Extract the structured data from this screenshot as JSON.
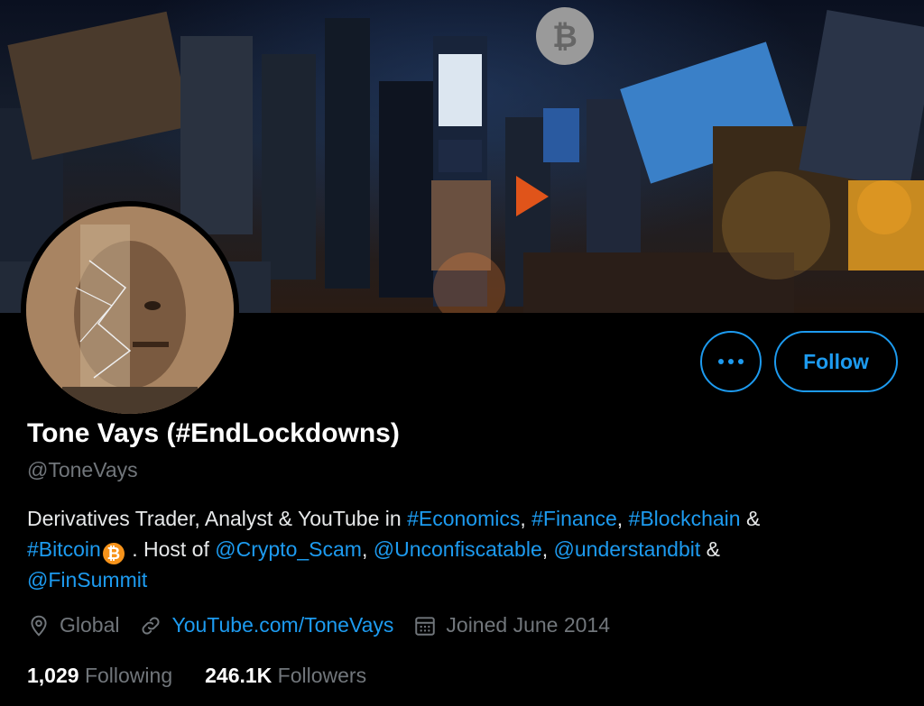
{
  "profile": {
    "display_name": "Tone Vays (#EndLockdowns)",
    "handle": "@ToneVays",
    "bio": {
      "part1": "Derivatives Trader, Analyst & YouTube in ",
      "tag_economics": "#Economics",
      "sep1": ", ",
      "tag_finance": "#Finance",
      "sep2": ", ",
      "tag_blockchain": "#Blockchain",
      "sep3": " & ",
      "tag_bitcoin": "#Bitcoin",
      "btc_glyph": "₿",
      "part2": " . Host of ",
      "mention_crypto_scam": "@Crypto_Scam",
      "sep4": ", ",
      "mention_unconfiscatable": "@Unconfiscatable",
      "sep5": ", ",
      "mention_understandbit": "@understandbit",
      "sep6": " & ",
      "mention_finsummit": "@FinSummit"
    },
    "location": "Global",
    "website": "YouTube.com/ToneVays",
    "joined": "Joined June 2014",
    "following_count": "1,029",
    "following_label": "Following",
    "followers_count": "246.1K",
    "followers_label": "Followers"
  },
  "actions": {
    "follow_label": "Follow"
  },
  "icons": {
    "more": "more-horizontal-icon",
    "location": "location-pin-icon",
    "website": "link-icon",
    "joined": "calendar-icon"
  },
  "colors": {
    "accent": "#1d9bf0",
    "muted": "#71767b",
    "background": "#000000",
    "bitcoin": "#f7931a"
  }
}
